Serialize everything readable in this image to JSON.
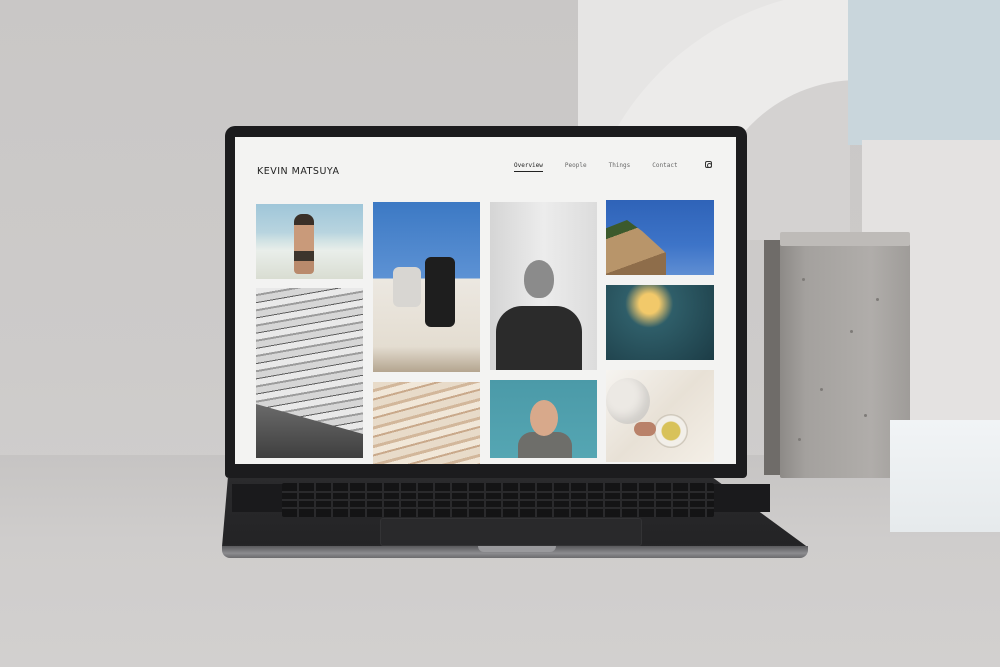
{
  "site": {
    "title": "KEVIN MATSUYA",
    "nav": [
      {
        "label": "Overview",
        "active": true
      },
      {
        "label": "People",
        "active": false
      },
      {
        "label": "Things",
        "active": false
      },
      {
        "label": "Contact",
        "active": false
      }
    ],
    "social_icon": "instagram-icon"
  },
  "gallery": {
    "photos": [
      "beach-swimmer-photo",
      "bleachers-photo",
      "wall-climbers-photo",
      "water-bottle-portrait-photo",
      "cliff-sky-photo",
      "lamp-interior-photo",
      "sand-texture-photo",
      "woman-hands-on-head-photo",
      "teapot-cup-photo"
    ]
  },
  "colors": {
    "screen_background": "#f3f3f2",
    "laptop_body": "#1c1c1e",
    "backdrop": "#cfcdcc"
  }
}
